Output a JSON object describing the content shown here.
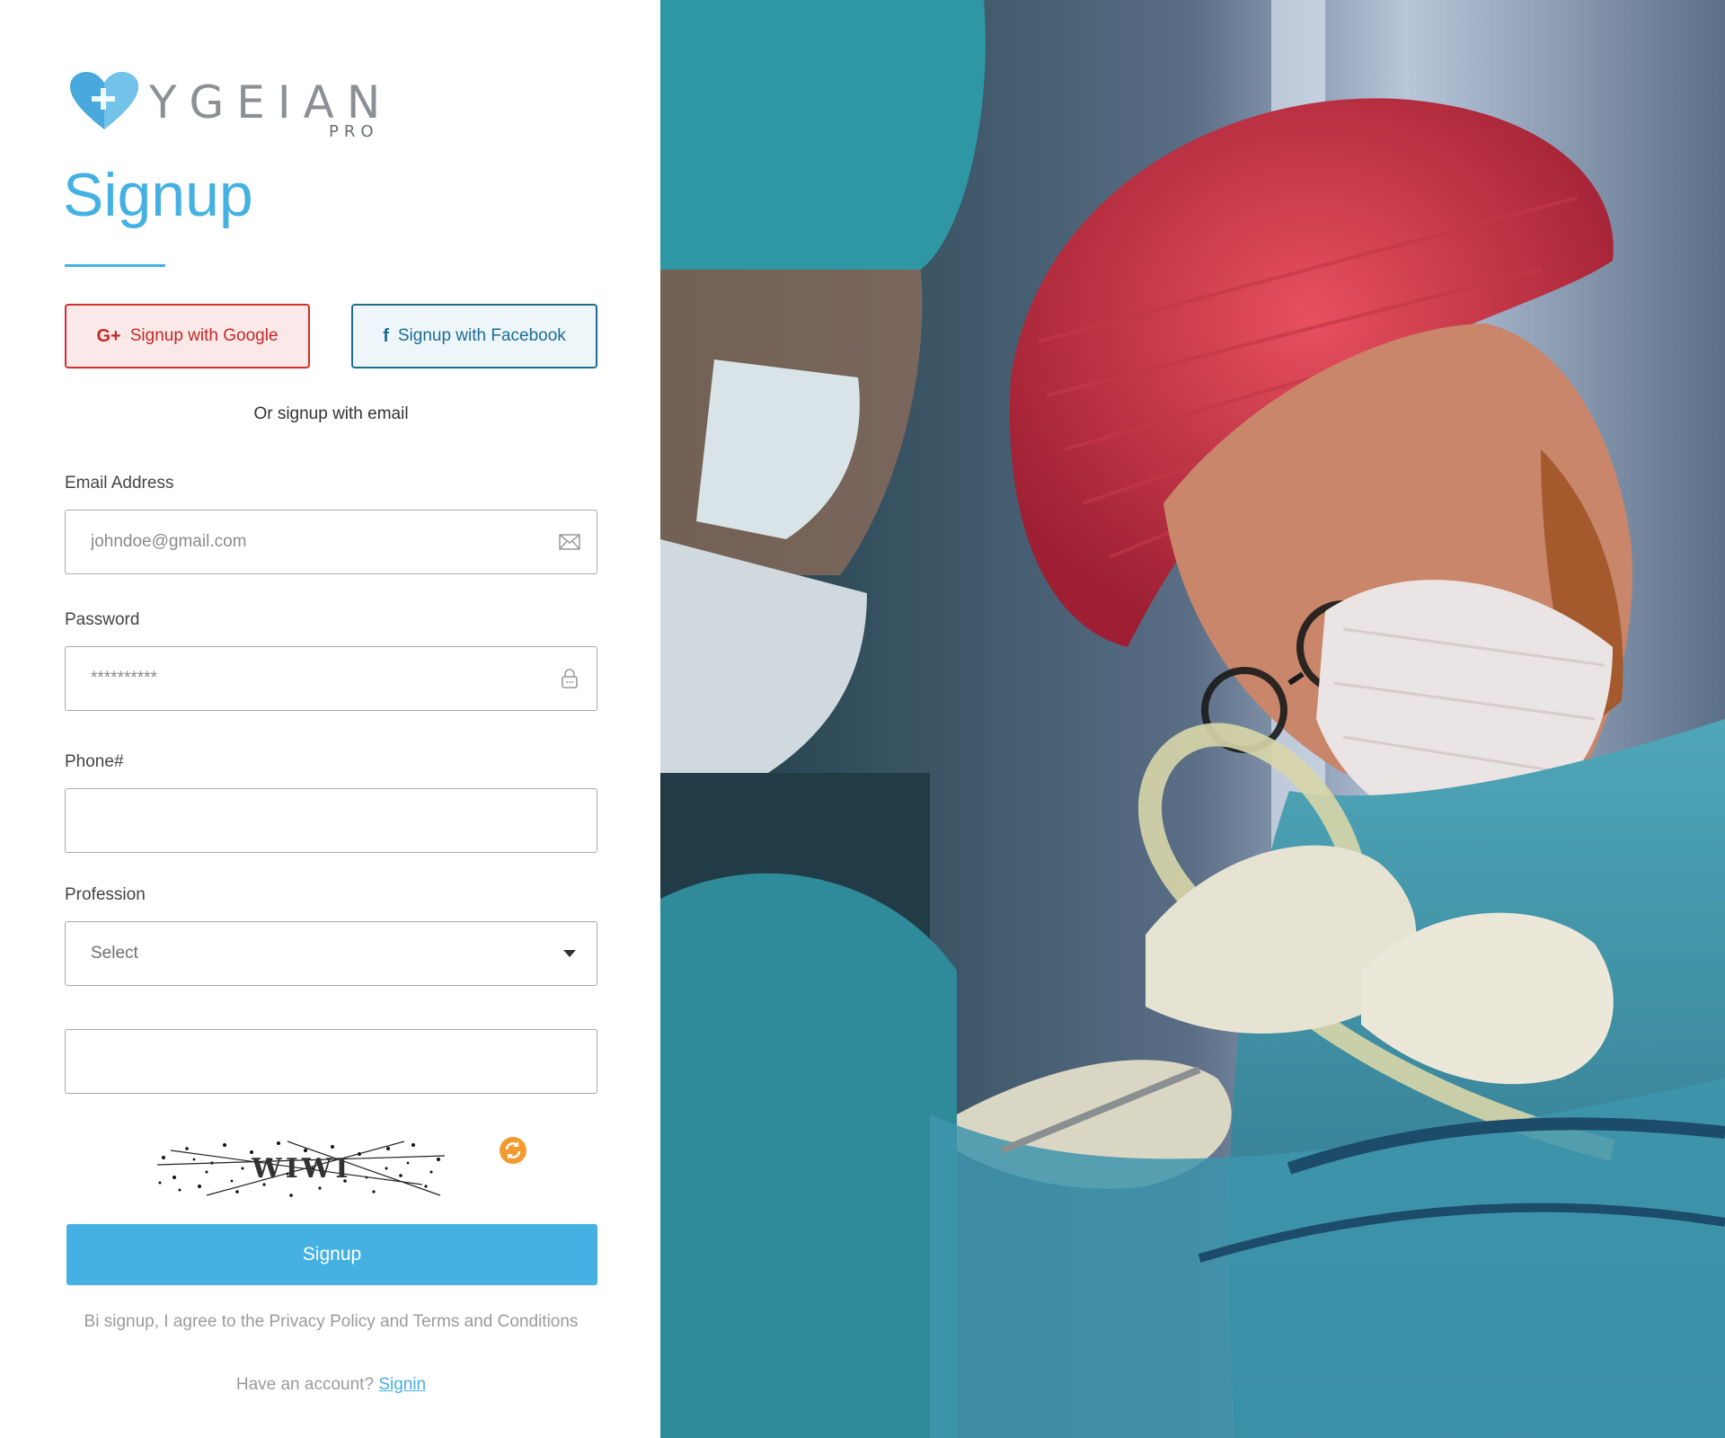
{
  "brand": {
    "name": "YGEIAN",
    "sub": "PRO"
  },
  "form": {
    "title": "Signup",
    "google_label": "Signup with Google",
    "facebook_label": "Signup with Facebook",
    "or_text": "Or signup with email",
    "email": {
      "label": "Email Address",
      "placeholder": "johndoe@gmail.com",
      "value": ""
    },
    "password": {
      "label": "Password",
      "placeholder": "**********",
      "value": ""
    },
    "phone": {
      "label": "Phone#",
      "value": ""
    },
    "profession": {
      "label": "Profession",
      "selected": "Select"
    },
    "captcha_input": {
      "value": ""
    },
    "captcha_text": "WIWI",
    "submit_label": "Signup",
    "terms_text": "Bi signup, I agree to the Privacy Policy and Terms and Conditions",
    "have_account_text": "Have an account?",
    "signin_label": "Signin"
  },
  "colors": {
    "accent": "#45b1e3",
    "google": "#d62d2d",
    "facebook": "#1d6d8f"
  }
}
